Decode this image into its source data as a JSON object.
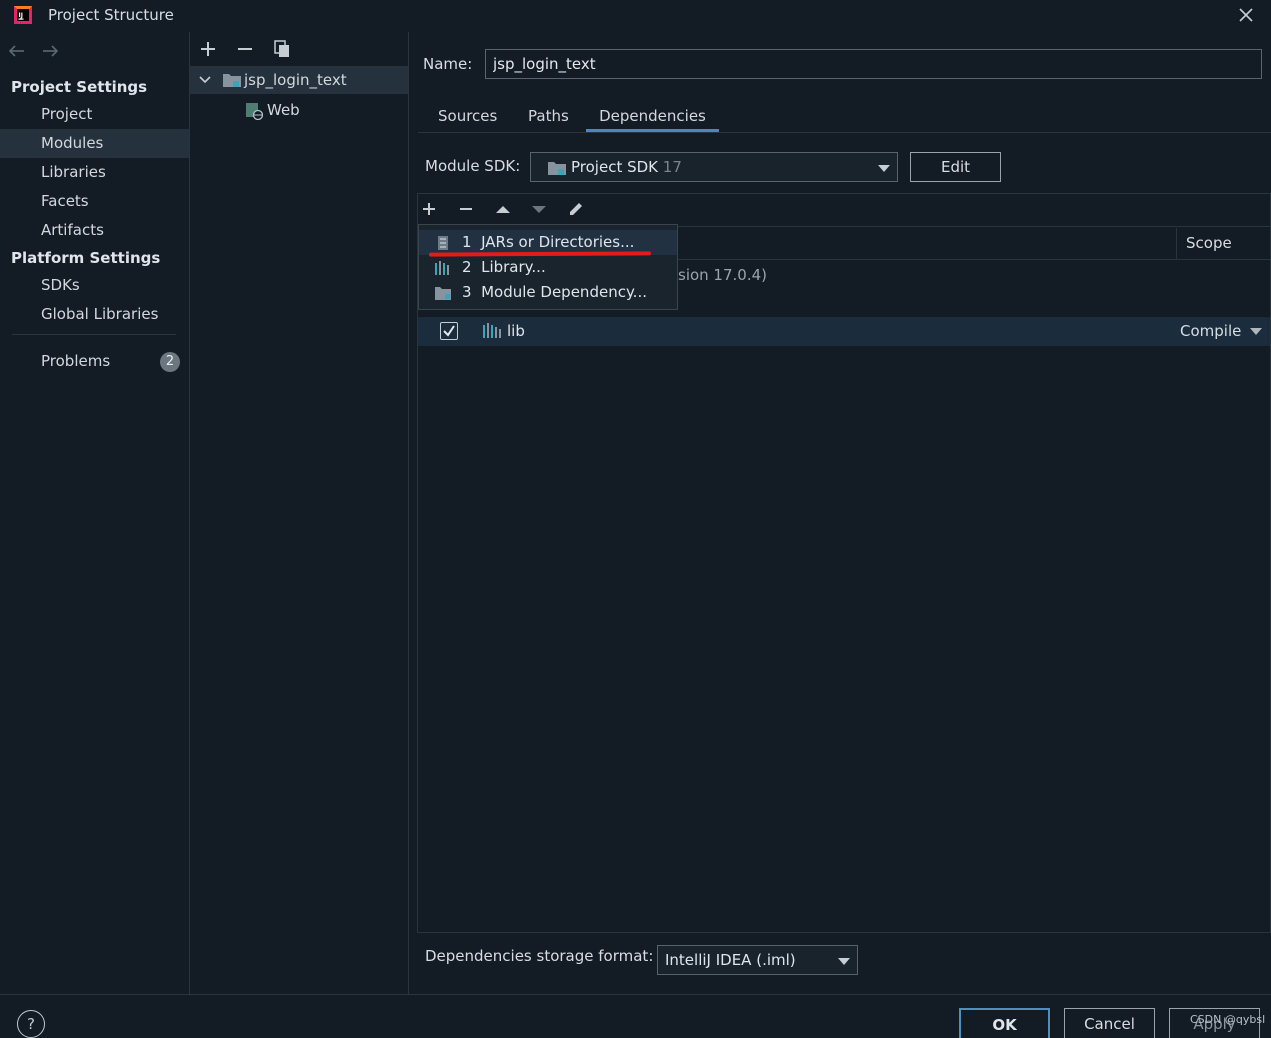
{
  "window": {
    "title": "Project Structure"
  },
  "sidebar": {
    "project_settings_heading": "Project Settings",
    "project_settings_items": [
      {
        "label": "Project"
      },
      {
        "label": "Modules"
      },
      {
        "label": "Libraries"
      },
      {
        "label": "Facets"
      },
      {
        "label": "Artifacts"
      }
    ],
    "platform_settings_heading": "Platform Settings",
    "platform_settings_items": [
      {
        "label": "SDKs"
      },
      {
        "label": "Global Libraries"
      }
    ],
    "problems": {
      "label": "Problems",
      "count": "2"
    },
    "selected": "Modules"
  },
  "module_tree": {
    "items": [
      {
        "label": "jsp_login_text"
      },
      {
        "label": "Web"
      }
    ]
  },
  "module": {
    "name_label": "Name:",
    "name_value": "jsp_login_text",
    "tabs": [
      {
        "label": "Sources"
      },
      {
        "label": "Paths"
      },
      {
        "label": "Dependencies"
      }
    ],
    "active_tab": "Dependencies",
    "sdk_label": "Module SDK:",
    "sdk_value": "Project SDK",
    "sdk_version": "17",
    "edit_label": "Edit",
    "scope_header": "Scope",
    "sdk_row_partial": "sion 17.0.4)",
    "dependencies": [
      {
        "name": "lib",
        "checked": true,
        "scope": "Compile"
      }
    ],
    "storage_label": "Dependencies storage format:",
    "storage_value": "IntelliJ IDEA (.iml)"
  },
  "add_popup": {
    "items": [
      {
        "num": "1",
        "label": "JARs or Directories..."
      },
      {
        "num": "2",
        "label": "Library..."
      },
      {
        "num": "3",
        "label": "Module Dependency..."
      }
    ]
  },
  "footer": {
    "help": "?",
    "ok": "OK",
    "cancel": "Cancel",
    "apply": "Apply",
    "watermark": "CSDN @qybsl"
  },
  "colors": {
    "background": "#131c24",
    "selection": "#25313c",
    "accent_blue": "#4a87c5",
    "annotation_red": "#e21b1b"
  }
}
